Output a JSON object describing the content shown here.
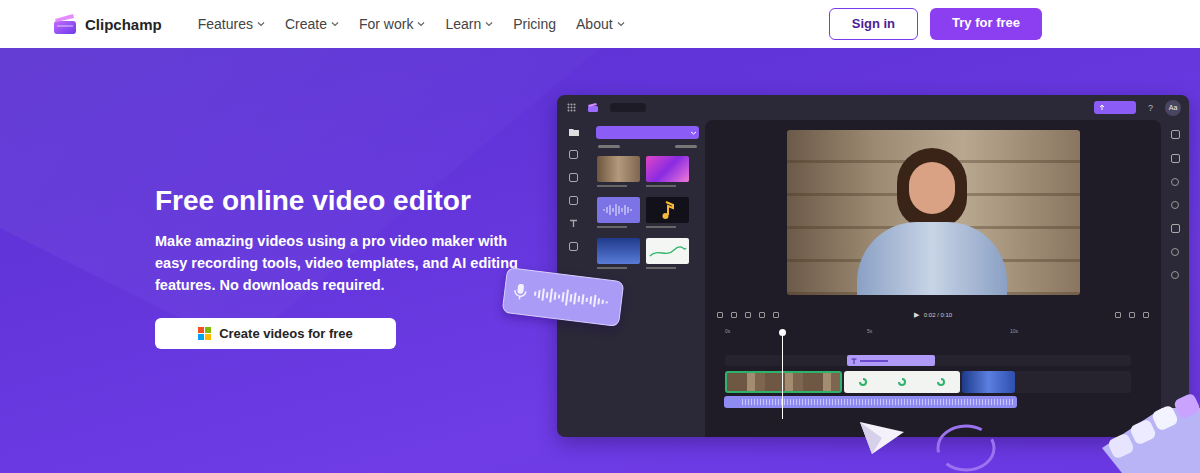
{
  "nav": {
    "logo": "Clipchamp",
    "items": [
      {
        "label": "Features",
        "dropdown": true
      },
      {
        "label": "Create",
        "dropdown": true
      },
      {
        "label": "For work",
        "dropdown": true
      },
      {
        "label": "Learn",
        "dropdown": true
      },
      {
        "label": "Pricing",
        "dropdown": false
      },
      {
        "label": "About",
        "dropdown": true
      }
    ],
    "sign_in": "Sign in",
    "try_free": "Try for free"
  },
  "hero": {
    "title": "Free online video editor",
    "subtitle": "Make amazing videos using a pro video maker with easy recording tools, video templates, and AI editing features. No downloads required.",
    "cta": "Create videos for free"
  },
  "editor": {
    "help": "?",
    "avatar": "Aa",
    "play": "▶",
    "time": "0:02 / 0:10",
    "ticks": [
      "0s",
      "5s",
      "10s"
    ]
  }
}
